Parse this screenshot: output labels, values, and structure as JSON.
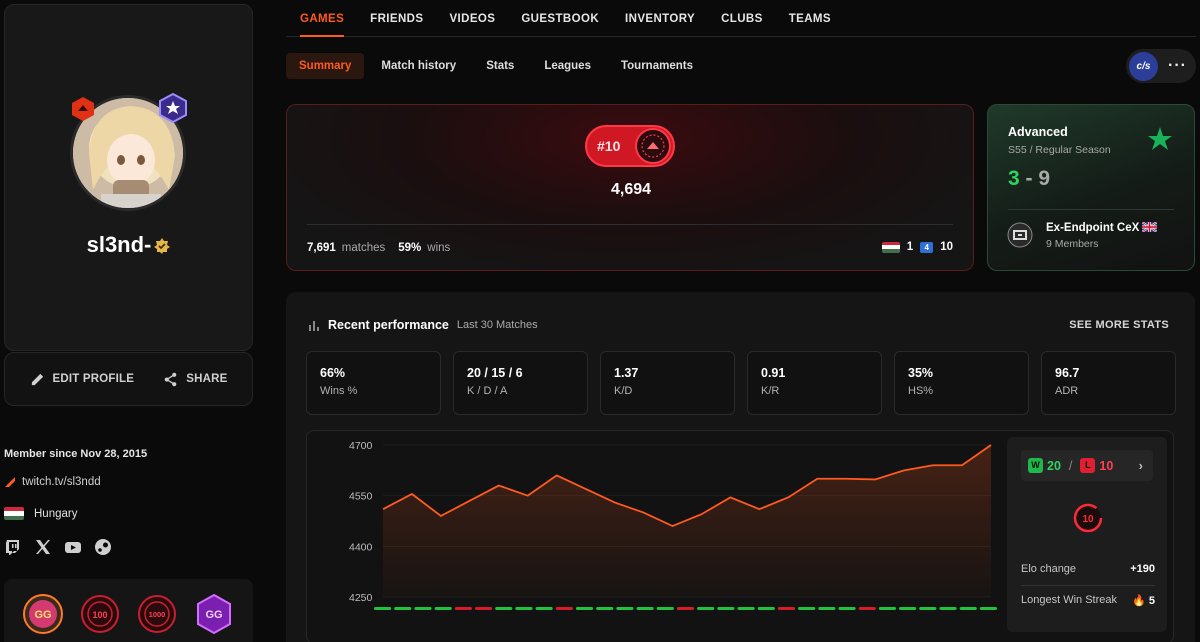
{
  "profile": {
    "username": "sl3nd-",
    "edit_label": "EDIT PROFILE",
    "share_label": "SHARE",
    "member_since": "Member since Nov 28, 2015",
    "twitch": "twitch.tv/sl3ndd",
    "country": "Hungary",
    "medals": [
      "GG 25",
      "100",
      "1000",
      "GG 24"
    ]
  },
  "nav": {
    "tabs": [
      "GAMES",
      "FRIENDS",
      "VIDEOS",
      "GUESTBOOK",
      "INVENTORY",
      "CLUBS",
      "TEAMS"
    ],
    "subtabs": [
      "Summary",
      "Match history",
      "Stats",
      "Leagues",
      "Tournaments"
    ],
    "team_logo_text": "c/s",
    "more": "···"
  },
  "elo": {
    "rank": "#10",
    "value": "4,694",
    "matches": "7,691",
    "matches_label": "matches",
    "wins_pct": "59%",
    "wins_label": "wins",
    "country_rank": "1",
    "region_rank": "10"
  },
  "league": {
    "tier": "Advanced",
    "season": "S55 / Regular Season",
    "wins": "3",
    "sep": "-",
    "losses": "9",
    "club_name": "Ex-Endpoint CeX",
    "club_members": "9 Members"
  },
  "performance": {
    "title": "Recent performance",
    "subtitle": "Last 30 Matches",
    "see_more": "SEE MORE STATS",
    "stats": [
      {
        "value": "66%",
        "label": "Wins %"
      },
      {
        "value": "20 / 15 / 6",
        "label": "K / D / A"
      },
      {
        "value": "1.37",
        "label": "K/D"
      },
      {
        "value": "0.91",
        "label": "K/R"
      },
      {
        "value": "35%",
        "label": "HS%"
      },
      {
        "value": "96.7",
        "label": "ADR"
      }
    ],
    "wins": "20",
    "win_letter": "W",
    "losses": "10",
    "loss_letter": "L",
    "slash": "/",
    "level": "10",
    "elo_change_label": "Elo change",
    "elo_change": "+190",
    "streak_label": "Longest Win Streak",
    "streak": "5"
  },
  "chart_data": {
    "type": "line",
    "yticks": [
      "4700",
      "4550",
      "4400",
      "4250"
    ],
    "ylim": [
      4250,
      4700
    ],
    "values": [
      4510,
      4555,
      4490,
      4535,
      4580,
      4550,
      4610,
      4570,
      4530,
      4500,
      4460,
      4495,
      4545,
      4510,
      4545,
      4600,
      4600,
      4598,
      4625,
      4640,
      4640,
      4700
    ],
    "results": [
      "W",
      "W",
      "W",
      "W",
      "L",
      "L",
      "W",
      "W",
      "W",
      "L",
      "W",
      "W",
      "W",
      "W",
      "W",
      "L",
      "W",
      "W",
      "W",
      "W",
      "L",
      "W",
      "W",
      "W",
      "L",
      "W",
      "W",
      "W",
      "W",
      "W",
      "W"
    ],
    "colors": {
      "line": "#ff5a1f",
      "win": "#22c23f",
      "loss": "#d41c2a"
    }
  }
}
